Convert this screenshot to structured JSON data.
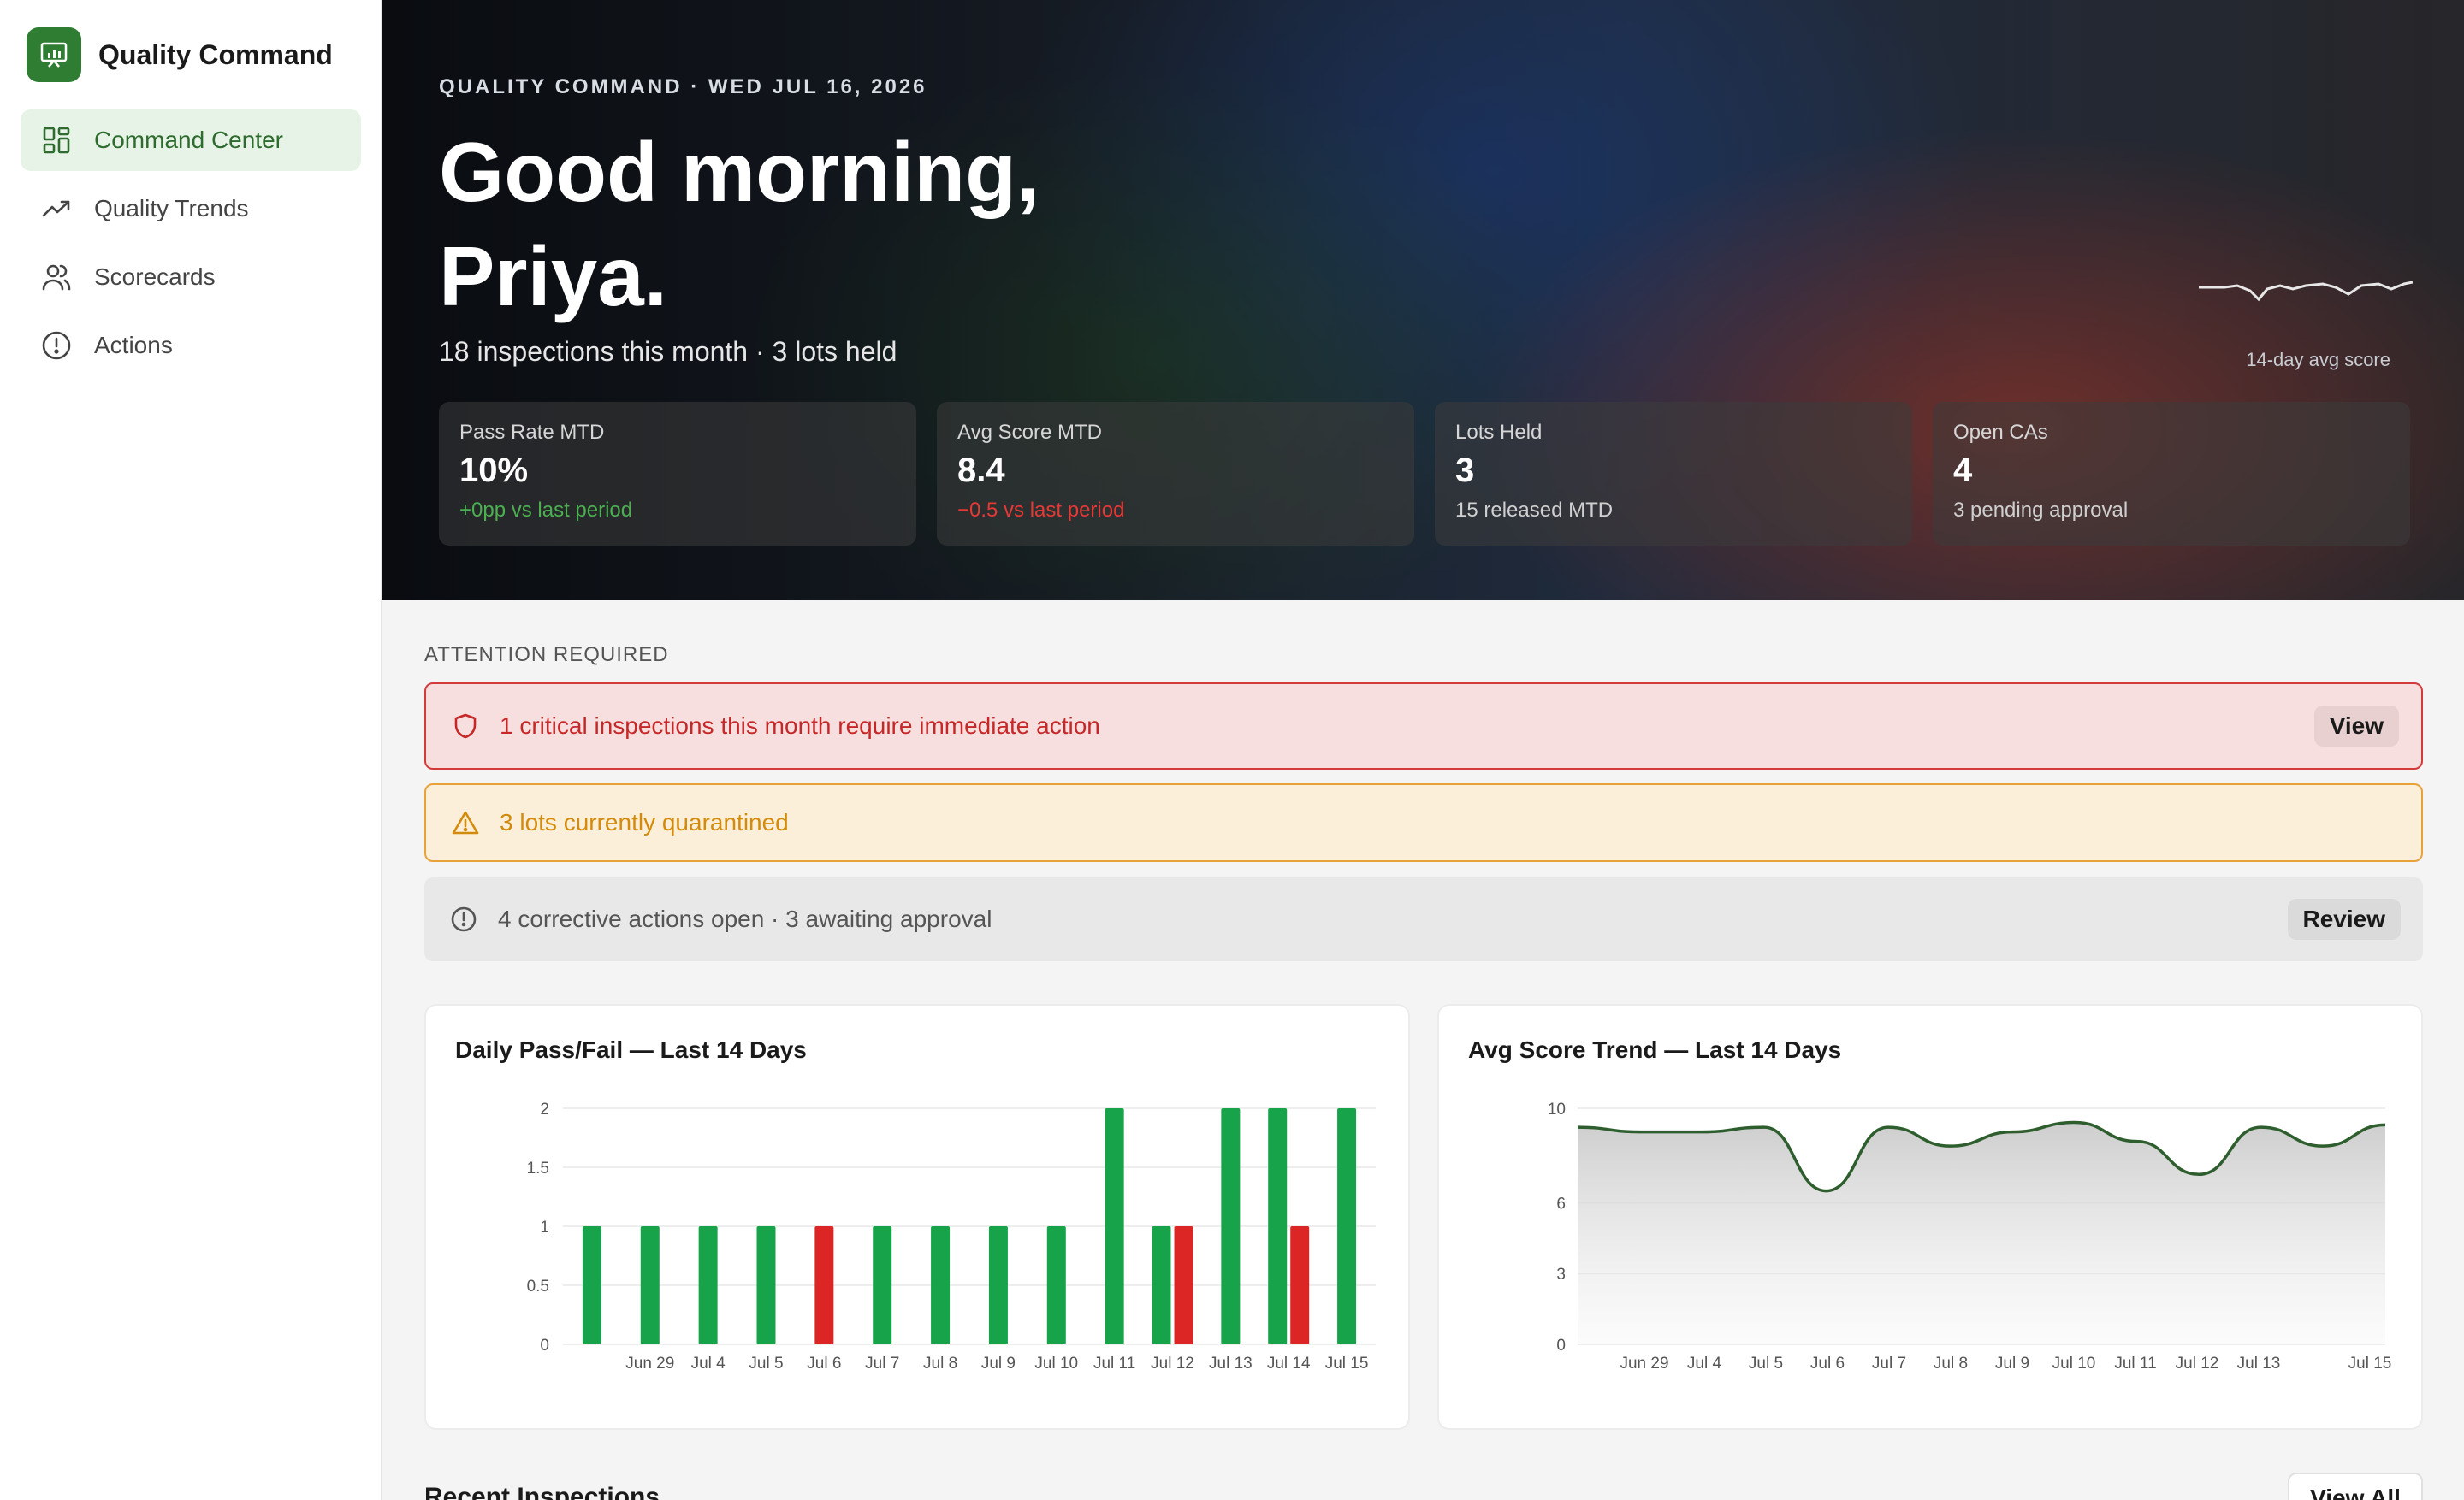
{
  "app": {
    "name": "Quality Command"
  },
  "sidebar": {
    "items": [
      {
        "label": "Command Center",
        "icon": "grid-icon",
        "active": true
      },
      {
        "label": "Quality Trends",
        "icon": "trend-icon",
        "active": false
      },
      {
        "label": "Scorecards",
        "icon": "users-icon",
        "active": false
      },
      {
        "label": "Actions",
        "icon": "alert-circle-icon",
        "active": false
      }
    ]
  },
  "hero": {
    "eyebrow": "QUALITY COMMAND · WED JUL 16, 2026",
    "greeting": "Good morning, Priya.",
    "subtitle": "18 inspections this month · 3 lots held",
    "sparkline_label": "14-day avg score",
    "kpis": [
      {
        "label": "Pass Rate MTD",
        "value": "10%",
        "delta": "+0pp vs last period",
        "tone": "pos"
      },
      {
        "label": "Avg Score MTD",
        "value": "8.4",
        "delta": "−0.5 vs last period",
        "tone": "neg"
      },
      {
        "label": "Lots Held",
        "value": "3",
        "delta": "15 released MTD",
        "tone": "neutral"
      },
      {
        "label": "Open CAs",
        "value": "4",
        "delta": "3 pending approval",
        "tone": "neutral"
      }
    ]
  },
  "attention": {
    "label": "ATTENTION REQUIRED",
    "critical": {
      "text": "1 critical inspections this month require immediate action",
      "button": "View"
    },
    "warning": {
      "text": "3 lots currently quarantined"
    },
    "info": {
      "text": "4 corrective actions open · 3 awaiting approval",
      "button": "Review"
    }
  },
  "colors": {
    "pass": "#16a34a",
    "fail": "#dc2626",
    "accent": "#2e7d32",
    "line": "#2e5e2e"
  },
  "chart_data": [
    {
      "type": "bar",
      "title": "Daily Pass/Fail — Last 14 Days",
      "categories": [
        "Jun 29",
        "Jul 4",
        "Jul 5",
        "Jul 6",
        "Jul 7",
        "Jul 8",
        "Jul 9",
        "Jul 10",
        "Jul 11",
        "Jul 12",
        "Jul 13",
        "Jul 14",
        "Jul 15"
      ],
      "yticks": [
        "0",
        "0.5",
        "1",
        "1.5",
        "2"
      ],
      "ylim": [
        0,
        2
      ],
      "series": [
        {
          "values": [
            1,
            1,
            1,
            1,
            0,
            1,
            1,
            1,
            1,
            2,
            1,
            2,
            2,
            2
          ]
        },
        {
          "values": [
            0,
            0,
            0,
            0,
            1,
            0,
            0,
            0,
            0,
            0,
            1,
            0,
            1,
            0
          ]
        }
      ],
      "grid": true
    },
    {
      "type": "area",
      "title": "Avg Score Trend — Last 14 Days",
      "categories": [
        "Jun 29",
        "Jul 4",
        "Jul 5",
        "Jul 6",
        "Jul 7",
        "Jul 8",
        "Jul 9",
        "Jul 10",
        "Jul 11",
        "Jul 12",
        "Jul 13",
        "Jul 15"
      ],
      "yticks": [
        "0",
        "3",
        "6",
        "10"
      ],
      "ylim": [
        0,
        10
      ],
      "values": [
        9.2,
        9.0,
        9.0,
        9.2,
        6.5,
        9.2,
        8.4,
        9.0,
        9.4,
        8.6,
        7.2,
        9.2,
        8.4,
        9.3
      ],
      "grid": true
    }
  ],
  "recent": {
    "title": "Recent Inspections",
    "button": "View All"
  }
}
